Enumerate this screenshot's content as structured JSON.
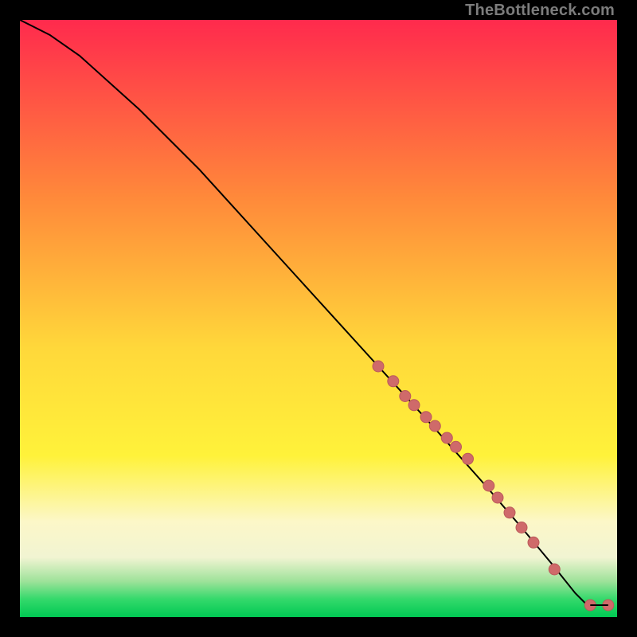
{
  "watermark": "TheBottleneck.com",
  "colors": {
    "top": "#ff2a4d",
    "upper_mid": "#ff8a3a",
    "mid": "#ffd83a",
    "lower_mid": "#fff23a",
    "cream": "#fcf7c8",
    "pale": "#f1f4d2",
    "green1": "#9ee29a",
    "green2": "#34d96b",
    "green3": "#00c853",
    "curve": "#000000",
    "dot": "#cf6a6a",
    "dot_stroke": "#bb5a5a"
  },
  "chart_data": {
    "type": "line",
    "title": "",
    "xlabel": "",
    "ylabel": "",
    "xlim": [
      0,
      100
    ],
    "ylim": [
      0,
      100
    ],
    "note": "x and y are normalized 0–100; y increases upward. Curve starts near top-left and descends to bottom-right. The cluster of dots marks data points along the lower-right portion of the curve plus two outliers on the bottom edge.",
    "series": [
      {
        "name": "curve",
        "x": [
          0,
          2,
          5,
          10,
          20,
          30,
          40,
          50,
          60,
          70,
          78,
          84,
          89,
          93,
          95
        ],
        "y": [
          100,
          99,
          97.5,
          94,
          85,
          75,
          64,
          53,
          42,
          31,
          22,
          15,
          9,
          4,
          2
        ]
      },
      {
        "name": "datapoints",
        "x": [
          60,
          62.5,
          64.5,
          66,
          68,
          69.5,
          71.5,
          73,
          75,
          78.5,
          80,
          82,
          84,
          86,
          89.5,
          95.5,
          98.5
        ],
        "y": [
          42,
          39.5,
          37,
          35.5,
          33.5,
          32,
          30,
          28.5,
          26.5,
          22,
          20,
          17.5,
          15,
          12.5,
          8,
          2,
          2
        ]
      }
    ],
    "gradient_stops_pct_from_top": [
      {
        "pct": 0,
        "color": "#ff2a4d"
      },
      {
        "pct": 30,
        "color": "#ff8a3a"
      },
      {
        "pct": 55,
        "color": "#ffd83a"
      },
      {
        "pct": 73,
        "color": "#fff23a"
      },
      {
        "pct": 84,
        "color": "#fcf7c8"
      },
      {
        "pct": 90,
        "color": "#f1f4d2"
      },
      {
        "pct": 94,
        "color": "#9ee29a"
      },
      {
        "pct": 97,
        "color": "#34d96b"
      },
      {
        "pct": 100,
        "color": "#00c853"
      }
    ]
  }
}
